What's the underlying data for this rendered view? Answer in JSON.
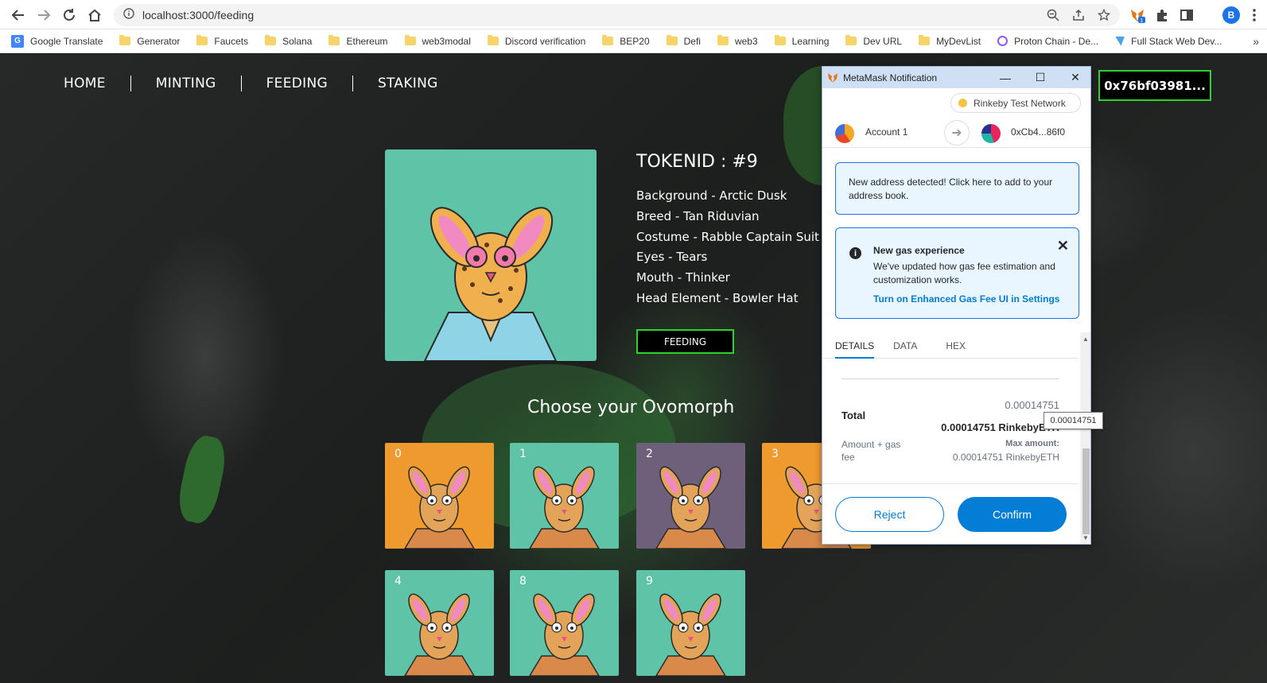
{
  "browser": {
    "url": "localhost:3000/feeding",
    "profile_initial": "B",
    "bookmarks": [
      "Google Translate",
      "Generator",
      "Faucets",
      "Solana",
      "Ethereum",
      "web3modal",
      "Discord verification",
      "BEP20",
      "Defi",
      "web3",
      "Learning",
      "Dev URL",
      "MyDevList",
      "Proton Chain - De...",
      "Full Stack Web Dev..."
    ],
    "bookmarks_more": "»"
  },
  "nav": {
    "items": [
      "HOME",
      "MINTING",
      "FEEDING",
      "STAKING"
    ]
  },
  "wallet": {
    "address": "0x76bf03981..."
  },
  "token": {
    "title": "TOKENID : #9",
    "traits": [
      "Background - Arctic Dusk",
      "Breed - Tan Riduvian",
      "Costume - Rabble Captain Suit",
      "Eyes - Tears",
      "Mouth - Thinker",
      "Head Element - Bowler Hat"
    ],
    "feed_button": "FEEDING",
    "bg_color": "#5ec3a7"
  },
  "gallery": {
    "heading": "Choose your Ovomorph",
    "cards": [
      {
        "id": "0",
        "bg": "#ee9a2e"
      },
      {
        "id": "1",
        "bg": "#5ec3a7"
      },
      {
        "id": "2",
        "bg": "#6e5f7a"
      },
      {
        "id": "3",
        "bg": "#ee9a2e"
      },
      {
        "id": "4",
        "bg": "#5ec3a7"
      },
      {
        "id": "8",
        "bg": "#5ec3a7"
      },
      {
        "id": "9",
        "bg": "#5ec3a7"
      }
    ]
  },
  "metamask": {
    "window_title": "MetaMask Notification",
    "network": "Rinkeby Test Network",
    "from_account": "Account 1",
    "to_address": "0xCb4...86f0",
    "new_address_notice": "New address detected! Click here to add to your address book.",
    "gas_title": "New gas experience",
    "gas_body": "We've updated how gas fee estimation and customization works.",
    "gas_link": "Turn on Enhanced Gas Fee UI in Settings",
    "tabs": [
      "DETAILS",
      "DATA",
      "HEX"
    ],
    "amount_top": "0.00014751",
    "total_label": "Total",
    "total_value": "0.00014751 RinkebyETH",
    "amount_gas_label": "Amount + gas fee",
    "max_amount_label": "Max amount:",
    "max_amount_value": "0.00014751 RinkebyETH",
    "reject": "Reject",
    "confirm": "Confirm",
    "tooltip": "0.00014751"
  },
  "colors": {
    "accent_green": "#2bd32b",
    "metamask_blue": "#037dd6"
  }
}
